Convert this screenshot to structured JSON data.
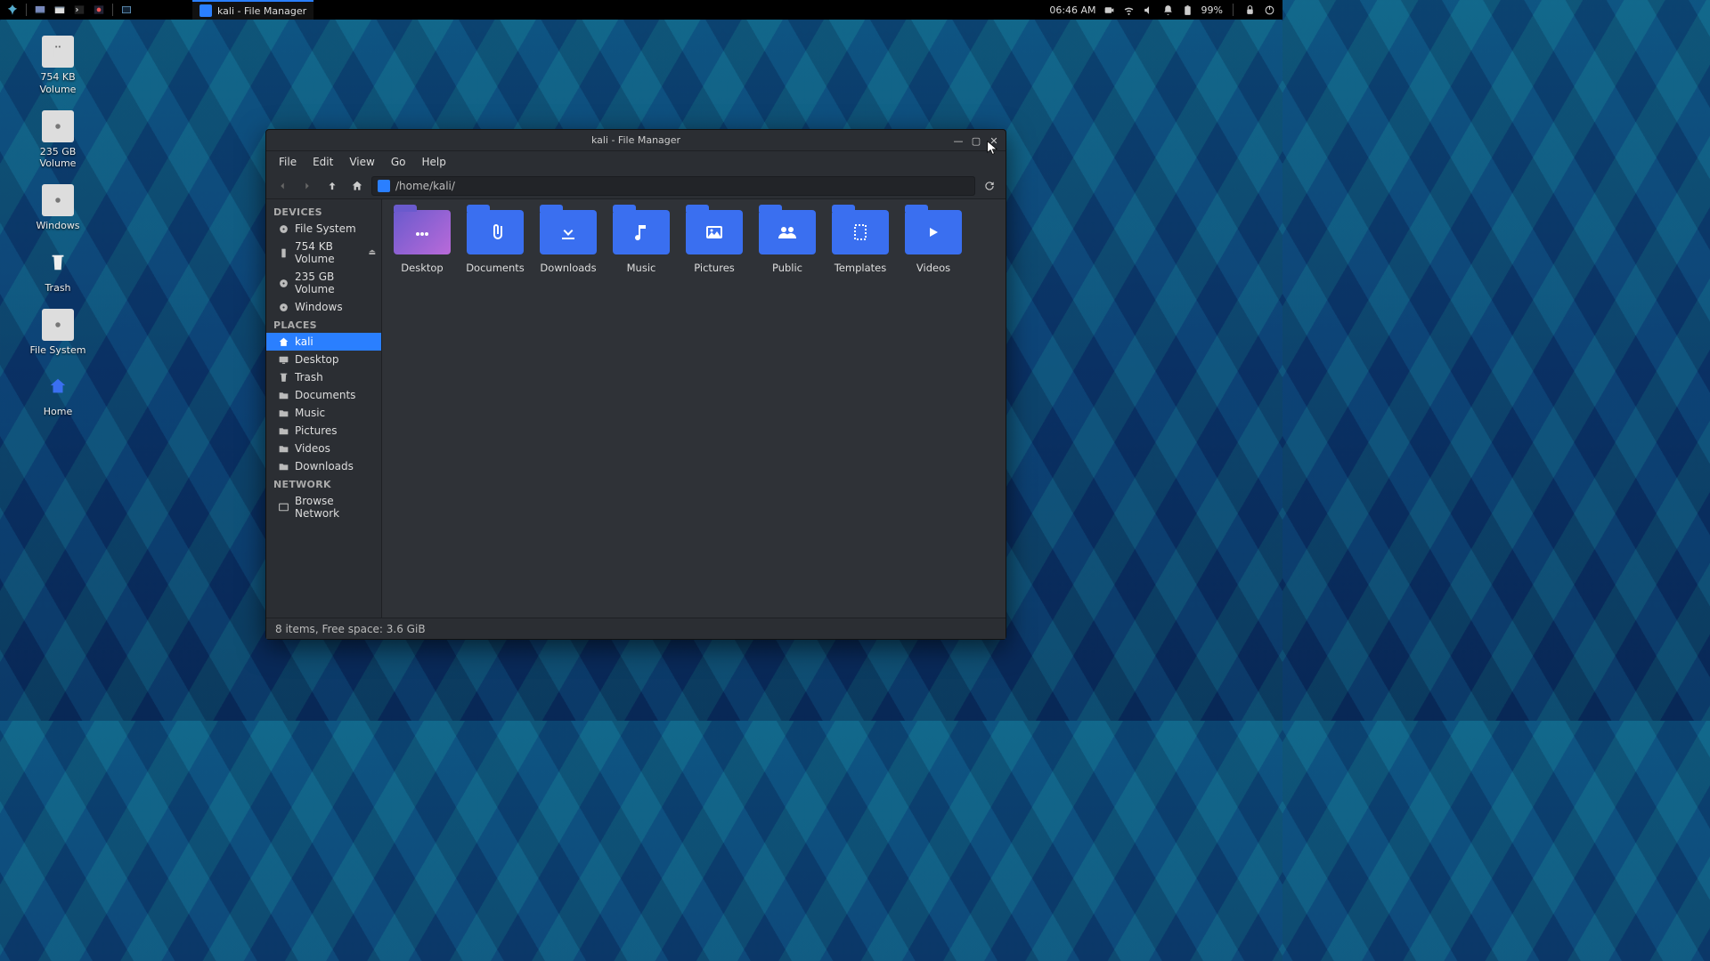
{
  "panel": {
    "task_label": "kali - File Manager",
    "time": "06:46 AM",
    "battery": "99%"
  },
  "desktop": {
    "icons": [
      {
        "label": "754 KB\nVolume",
        "kind": "usb"
      },
      {
        "label": "235 GB\nVolume",
        "kind": "disk"
      },
      {
        "label": "Windows",
        "kind": "disk"
      },
      {
        "label": "Trash",
        "kind": "trash"
      },
      {
        "label": "File System",
        "kind": "disk"
      },
      {
        "label": "Home",
        "kind": "home"
      }
    ]
  },
  "window": {
    "title": "kali - File Manager",
    "menu": [
      "File",
      "Edit",
      "View",
      "Go",
      "Help"
    ],
    "path": "/home/kali/",
    "sidebar": {
      "devices_head": "DEVICES",
      "devices": [
        {
          "label": "File System",
          "icon": "disk"
        },
        {
          "label": "754 KB Volume",
          "icon": "usb",
          "eject": true
        },
        {
          "label": "235 GB Volume",
          "icon": "disk"
        },
        {
          "label": "Windows",
          "icon": "disk"
        }
      ],
      "places_head": "PLACES",
      "places": [
        {
          "label": "kali",
          "icon": "home",
          "selected": true
        },
        {
          "label": "Desktop",
          "icon": "desktop"
        },
        {
          "label": "Trash",
          "icon": "trash"
        },
        {
          "label": "Documents",
          "icon": "folder"
        },
        {
          "label": "Music",
          "icon": "folder"
        },
        {
          "label": "Pictures",
          "icon": "folder"
        },
        {
          "label": "Videos",
          "icon": "folder"
        },
        {
          "label": "Downloads",
          "icon": "folder"
        }
      ],
      "network_head": "NETWORK",
      "network": [
        {
          "label": "Browse Network",
          "icon": "network"
        }
      ]
    },
    "folders": [
      {
        "label": "Desktop",
        "icon": "dots",
        "variant": "desktop"
      },
      {
        "label": "Documents",
        "icon": "clip"
      },
      {
        "label": "Downloads",
        "icon": "download"
      },
      {
        "label": "Music",
        "icon": "music"
      },
      {
        "label": "Pictures",
        "icon": "image"
      },
      {
        "label": "Public",
        "icon": "people"
      },
      {
        "label": "Templates",
        "icon": "template"
      },
      {
        "label": "Videos",
        "icon": "video"
      }
    ],
    "status": "8 items, Free space: 3.6 GiB"
  }
}
